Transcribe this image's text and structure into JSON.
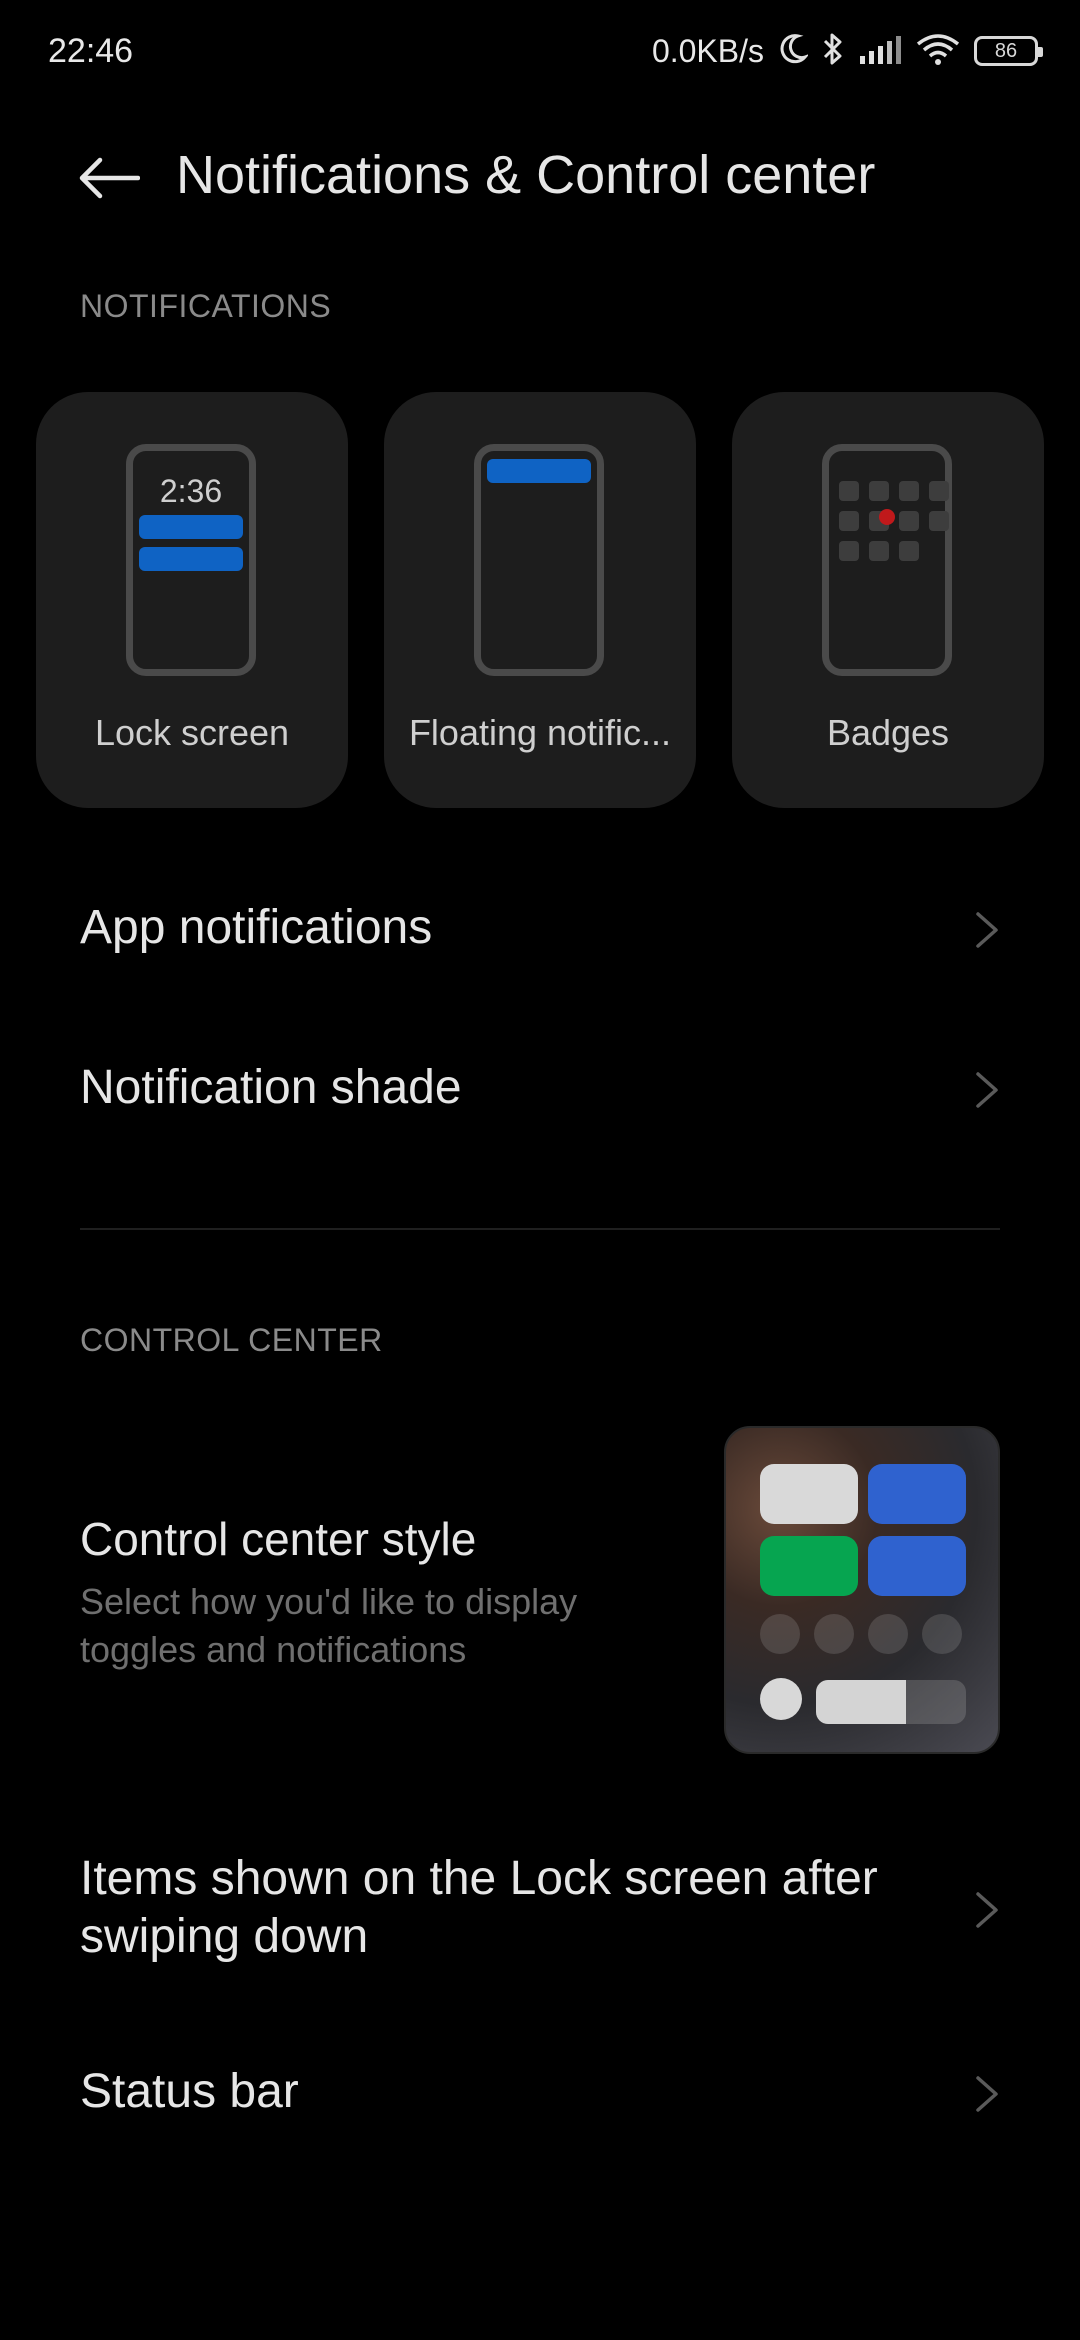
{
  "status_bar": {
    "time": "22:46",
    "speed": "0.0KB/s",
    "battery": "86"
  },
  "header": {
    "title": "Notifications & Control center"
  },
  "notifications_section": {
    "header": "NOTIFICATIONS",
    "cards": [
      {
        "label": "Lock screen",
        "preview_time": "2:36"
      },
      {
        "label": "Floating notific..."
      },
      {
        "label": "Badges"
      }
    ],
    "rows": [
      {
        "label": "App notifications"
      },
      {
        "label": "Notification shade"
      }
    ]
  },
  "control_center_section": {
    "header": "CONTROL CENTER",
    "style": {
      "title": "Control center style",
      "subtitle": "Select how you'd like to display toggles and notifications"
    },
    "rows": [
      {
        "label": "Items shown on the Lock screen after swiping down"
      },
      {
        "label": "Status bar"
      }
    ]
  },
  "colors": {
    "background": "#000000",
    "card": "#1d1d1d",
    "accent_blue": "#0f63c4",
    "toggle_green": "#06a550",
    "badge_red": "#c0191b"
  },
  "cc_preview": {
    "brightness_level": 0.6
  }
}
